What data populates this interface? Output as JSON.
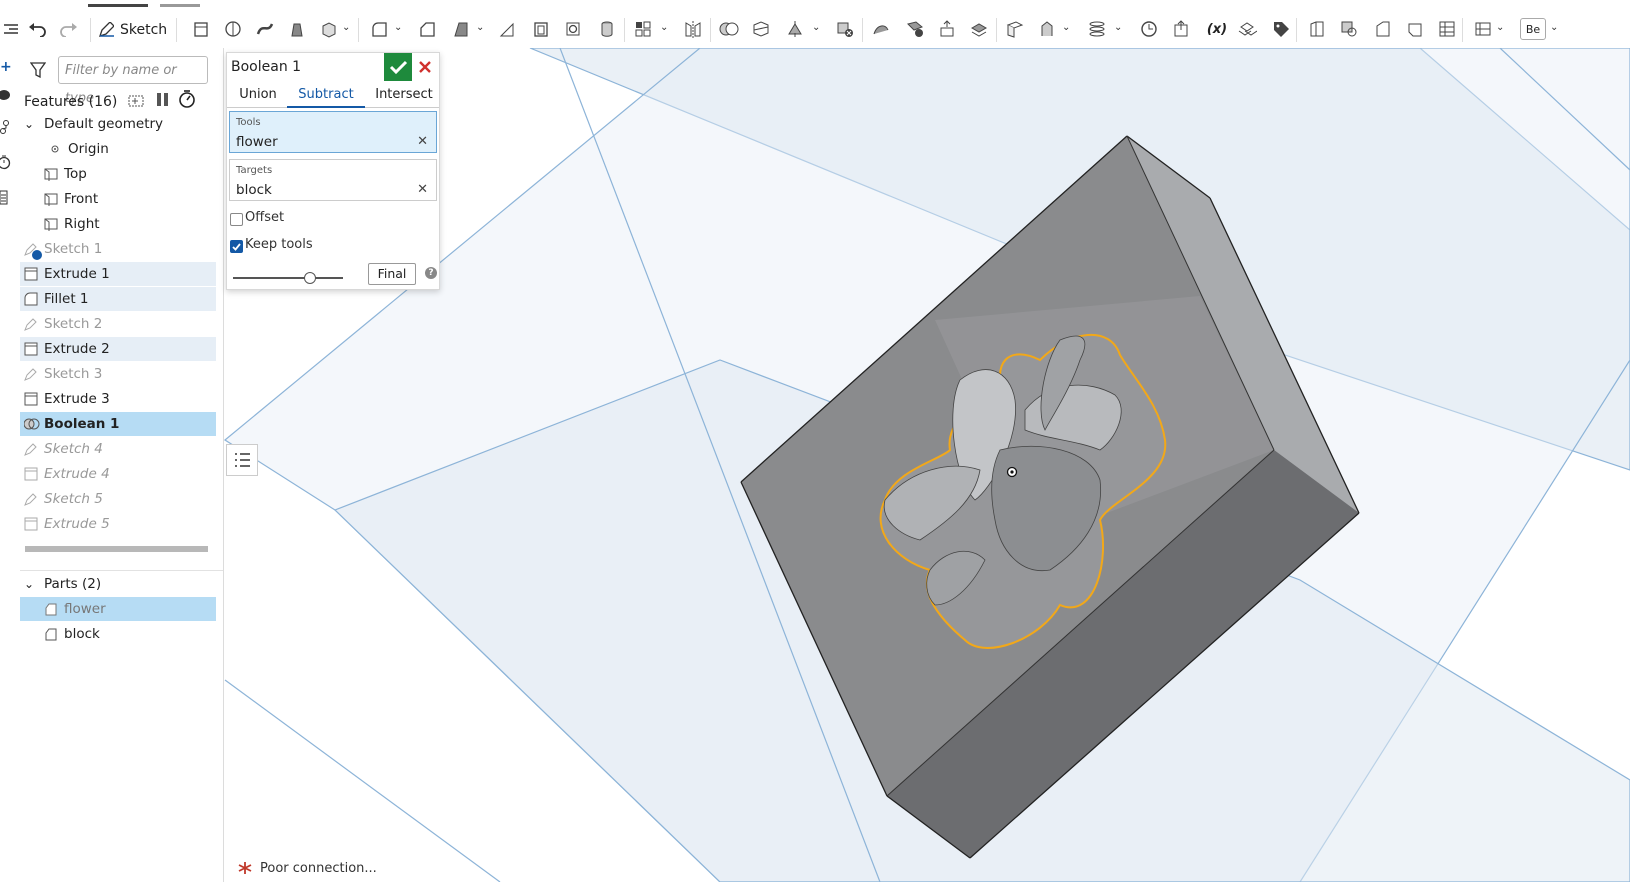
{
  "toolbar": {
    "sketch_label": "Sketch",
    "appearance_label": "Be",
    "variable_label": "(x)"
  },
  "features": {
    "filter_placeholder": "Filter by name or type",
    "header": "Features (16)",
    "default_geometry": "Default geometry",
    "items": [
      {
        "label": "Origin"
      },
      {
        "label": "Top"
      },
      {
        "label": "Front"
      },
      {
        "label": "Right"
      },
      {
        "label": "Sketch 1"
      },
      {
        "label": "Extrude 1"
      },
      {
        "label": "Fillet 1"
      },
      {
        "label": "Sketch 2"
      },
      {
        "label": "Extrude 2"
      },
      {
        "label": "Sketch 3"
      },
      {
        "label": "Extrude 3"
      },
      {
        "label": "Boolean 1"
      },
      {
        "label": "Sketch 4"
      },
      {
        "label": "Extrude 4"
      },
      {
        "label": "Sketch 5"
      },
      {
        "label": "Extrude 5"
      }
    ]
  },
  "parts": {
    "header": "Parts (2)",
    "items": [
      {
        "label": "flower"
      },
      {
        "label": "block"
      }
    ]
  },
  "dialog": {
    "title": "Boolean 1",
    "tabs": [
      "Union",
      "Subtract",
      "Intersect"
    ],
    "active_tab": "Subtract",
    "tools_label": "Tools",
    "tools_value": "flower",
    "targets_label": "Targets",
    "targets_value": "block",
    "offset_label": "Offset",
    "offset_checked": false,
    "keep_tools_label": "Keep tools",
    "keep_tools_checked": true,
    "final_label": "Final",
    "help_label": "?"
  },
  "status": {
    "text": "Poor connection..."
  },
  "colors": {
    "accent": "#1459a6",
    "ok": "#1e8a3c",
    "cancel": "#d0312d",
    "active_row": "#b6dcf4",
    "highlight_edge": "#f2a819",
    "plane_line": "#8db4d8"
  }
}
